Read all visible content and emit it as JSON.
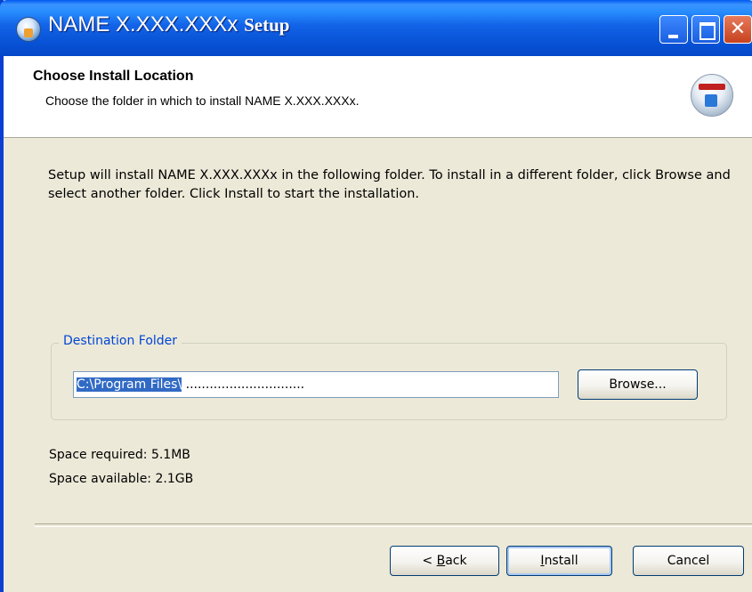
{
  "window": {
    "title_main": "NAME  X.XXX.XXXx",
    "title_setup": "Setup",
    "controls": [
      "minimize",
      "maximize",
      "close"
    ]
  },
  "header": {
    "title": "Choose Install Location",
    "subtitle": "Choose the folder in which to install NAME X.XXX.XXXx."
  },
  "body": {
    "description": "Setup will install  NAME X.XXX.XXXx  in the following folder. To install in a different folder, click Browse and select another folder. Click Install to start the installation."
  },
  "destination": {
    "legend": "Destination Folder",
    "path_selected": "C:\\Program Files\\",
    "path_rest": " ..............................",
    "browse_label": "Browse..."
  },
  "space": {
    "required": "Space required: 5.1MB",
    "available": "Space available: 2.1GB"
  },
  "footer": {
    "back_prefix": "< ",
    "back_key": "B",
    "back_rest": "ack",
    "install_key": "I",
    "install_rest": "nstall",
    "cancel_label": "Cancel"
  },
  "colors": {
    "titlebar": "#0A53D6",
    "dialog_bg": "#ECE9D8",
    "legend_text": "#0046D5",
    "selection": "#316AC5"
  }
}
